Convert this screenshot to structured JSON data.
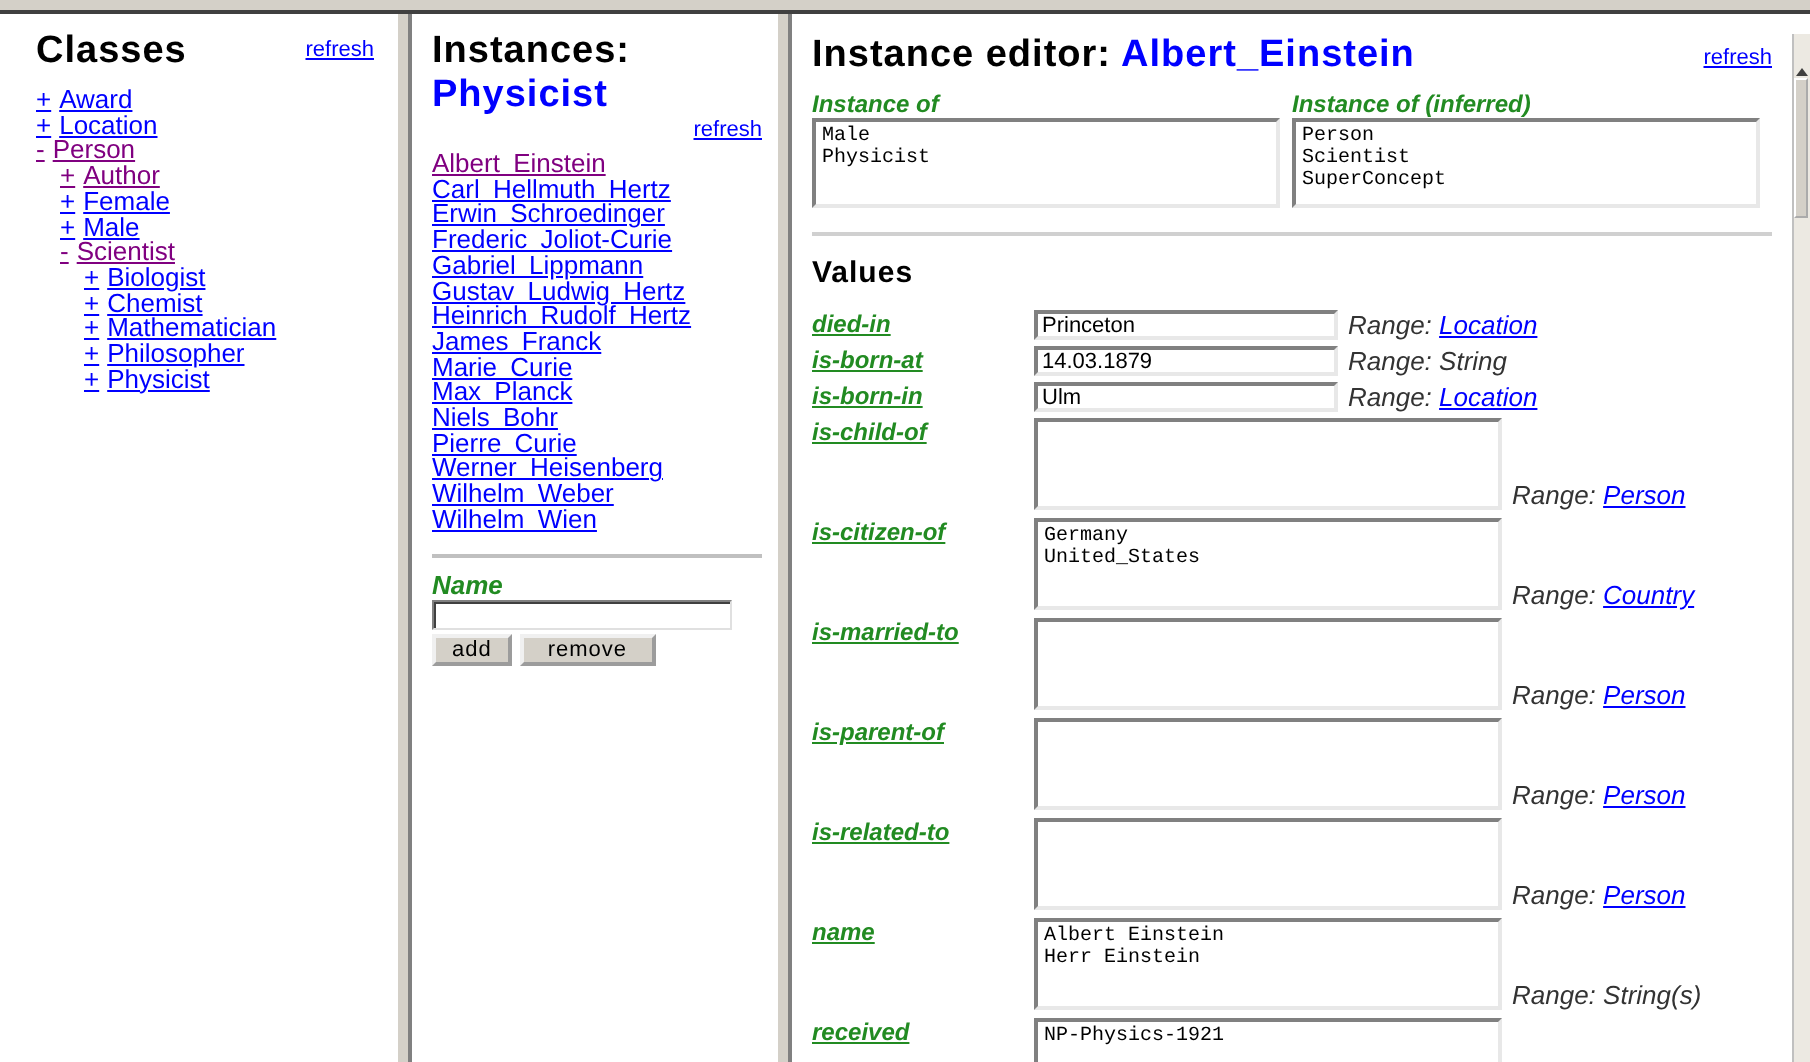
{
  "classes": {
    "title": "Classes",
    "refresh": "refresh",
    "tree": [
      {
        "toggle": "+",
        "label": "Award",
        "visited": false
      },
      {
        "toggle": "+",
        "label": "Location",
        "visited": false
      },
      {
        "toggle": "-",
        "label": "Person",
        "visited": true,
        "children": [
          {
            "toggle": "+",
            "label": "Author",
            "visited": true
          },
          {
            "toggle": "+",
            "label": "Female",
            "visited": false
          },
          {
            "toggle": "+",
            "label": "Male",
            "visited": false
          },
          {
            "toggle": "-",
            "label": "Scientist",
            "visited": true,
            "children": [
              {
                "toggle": "+",
                "label": "Biologist",
                "visited": false
              },
              {
                "toggle": "+",
                "label": "Chemist",
                "visited": false
              },
              {
                "toggle": "+",
                "label": "Mathematician",
                "visited": false
              },
              {
                "toggle": "+",
                "label": "Philosopher",
                "visited": false
              },
              {
                "toggle": "+",
                "label": "Physicist",
                "visited": false
              }
            ]
          }
        ]
      }
    ]
  },
  "instances": {
    "title": "Instances:",
    "class_name": "Physicist",
    "refresh": "refresh",
    "items": [
      {
        "label": "Albert Einstein",
        "visited": true
      },
      {
        "label": "Carl Hellmuth Hertz",
        "visited": false
      },
      {
        "label": "Erwin Schroedinger",
        "visited": false
      },
      {
        "label": "Frederic Joliot-Curie",
        "visited": false
      },
      {
        "label": "Gabriel Lippmann",
        "visited": false
      },
      {
        "label": "Gustav Ludwig Hertz",
        "visited": false
      },
      {
        "label": "Heinrich Rudolf Hertz",
        "visited": false
      },
      {
        "label": "James Franck",
        "visited": false
      },
      {
        "label": "Marie Curie",
        "visited": false
      },
      {
        "label": "Max Planck",
        "visited": false
      },
      {
        "label": "Niels Bohr",
        "visited": false
      },
      {
        "label": "Pierre Curie",
        "visited": false
      },
      {
        "label": "Werner Heisenberg",
        "visited": false
      },
      {
        "label": "Wilhelm Weber",
        "visited": false
      },
      {
        "label": "Wilhelm Wien",
        "visited": false
      }
    ],
    "name_label": "Name",
    "buttons": [
      "add",
      "remove"
    ]
  },
  "editor": {
    "title": "Instance editor:",
    "instance": "Albert_Einstein",
    "refresh": "refresh",
    "instance_of": {
      "label": "Instance of",
      "values": [
        "Male",
        "Physicist"
      ]
    },
    "instance_of_inferred": {
      "label": "Instance of (inferred)",
      "values": [
        "Person",
        "Scientist",
        "SuperConcept"
      ]
    },
    "values_heading": "Values",
    "rows": [
      {
        "property": "died-in",
        "kind": "single",
        "values": [
          "Princeton"
        ],
        "range_label": "Range:",
        "range": "Location",
        "range_link": true
      },
      {
        "property": "is-born-at",
        "kind": "single",
        "values": [
          "14.03.1879"
        ],
        "range_label": "Range:",
        "range": "String",
        "range_link": false
      },
      {
        "property": "is-born-in",
        "kind": "single",
        "values": [
          "Ulm"
        ],
        "range_label": "Range:",
        "range": "Location",
        "range_link": true
      },
      {
        "property": "is-child-of",
        "kind": "multi",
        "values": [],
        "range_label": "Range:",
        "range": "Person",
        "range_link": true
      },
      {
        "property": "is-citizen-of",
        "kind": "multi",
        "values": [
          "Germany",
          "United_States"
        ],
        "range_label": "Range:",
        "range": "Country",
        "range_link": true
      },
      {
        "property": "is-married-to",
        "kind": "multi",
        "values": [],
        "range_label": "Range:",
        "range": "Person",
        "range_link": true
      },
      {
        "property": "is-parent-of",
        "kind": "multi",
        "values": [],
        "range_label": "Range:",
        "range": "Person",
        "range_link": true
      },
      {
        "property": "is-related-to",
        "kind": "multi",
        "values": [],
        "range_label": "Range:",
        "range": "Person",
        "range_link": true
      },
      {
        "property": "name",
        "kind": "multi",
        "values": [
          "Albert Einstein",
          "Herr Einstein"
        ],
        "range_label": "Range:",
        "range": "String(s)",
        "range_link": false
      },
      {
        "property": "received",
        "kind": "multi",
        "values": [
          "NP-Physics-1921"
        ]
      }
    ]
  }
}
